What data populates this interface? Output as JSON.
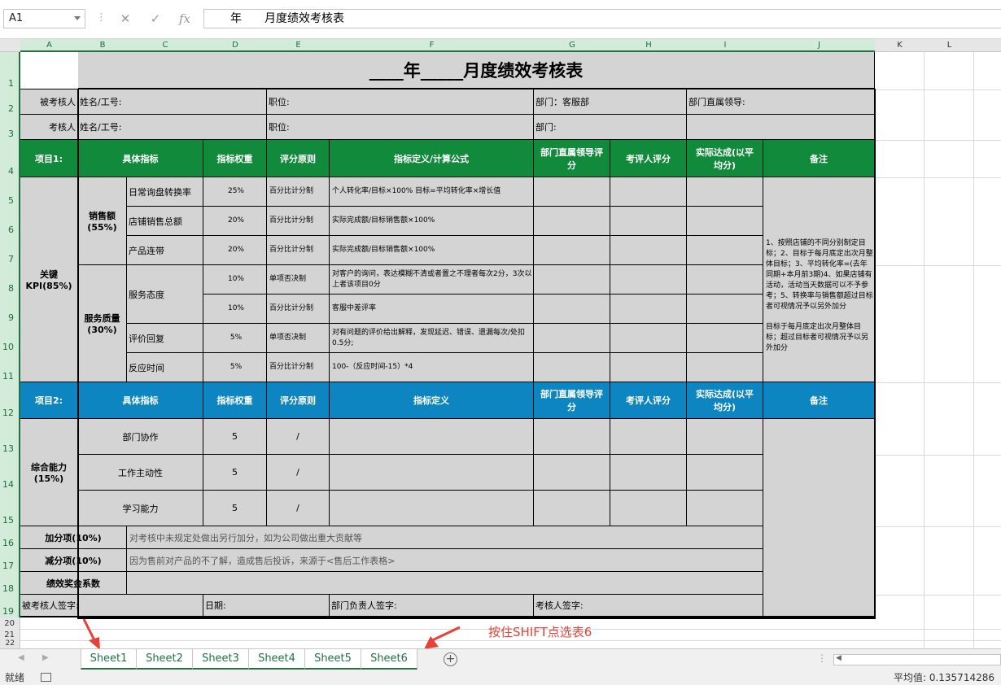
{
  "formula_bar": {
    "name_box": "A1",
    "cancel": "✕",
    "enter": "✓",
    "fx": "fx",
    "content": "年　　月度绩效考核表"
  },
  "columns": [
    "A",
    "B",
    "C",
    "D",
    "E",
    "F",
    "G",
    "H",
    "I",
    "J",
    "K",
    "L"
  ],
  "rows": [
    "1",
    "2",
    "3",
    "4",
    "5",
    "6",
    "7",
    "8",
    "9",
    "10",
    "11",
    "12",
    "13",
    "14",
    "15",
    "16",
    "17",
    "18",
    "19",
    "20",
    "21",
    "22"
  ],
  "title": "____年_____月度绩效考核表",
  "header": {
    "appraisee": "被考核人",
    "appraiser": "考核人",
    "name_id": "姓名/工号:",
    "position": "职位:",
    "dept_value": "部门：客服部",
    "dept": "部门:",
    "leader": "部门直属领导:"
  },
  "sec1": {
    "project": "项目1:",
    "indicator": "具体指标",
    "weight": "指标权重",
    "principle": "评分原则",
    "definition": "指标定义/计算公式",
    "leader_score": "部门直属领导评分",
    "reviewer_score": "考评人评分",
    "actual": "实际达成(以平均分)",
    "remarks": "备注"
  },
  "kpi": {
    "label": "关键KPI(85%)",
    "sales": "销售额(55%)",
    "service": "服务质量(30%)",
    "items": [
      {
        "name": "日常询盘转换率",
        "weight": "25%",
        "principle": "百分比计分制",
        "def": "个人转化率/目标×100% 目标=平均转化率×增长值"
      },
      {
        "name": "店铺销售总额",
        "weight": "20%",
        "principle": "百分比计分制",
        "def": "实际完成额/目标销售额×100%"
      },
      {
        "name": "产品连带",
        "weight": "20%",
        "principle": "百分比计分制",
        "def": "实际完成额/目标销售额×100%"
      },
      {
        "name": "服务态度",
        "weight": "10%",
        "principle": "单项否决制",
        "def": "对客户的询问，表达模糊不清或者置之不理者每次2分，3次以上者该项目0分"
      },
      {
        "name": "",
        "weight": "10%",
        "principle": "百分比计分制",
        "def": "客服中差评率"
      },
      {
        "name": "评价回复",
        "weight": "5%",
        "principle": "单项否决制",
        "def": "对有问题的评价给出解释，发现延迟、错误、遗漏每次/处扣0.5分;"
      },
      {
        "name": "反应时间",
        "weight": "5%",
        "principle": "百分比计分制",
        "def": "100-（反应时间-15）*4"
      }
    ],
    "remark_top": "1、按照店铺的不同分别制定目标；2、目标于每月底定出次月整体目标；3、平均转化率=(去年同期+本月前3期)4、如果店铺有活动，活动当天数据可以不予参考；5、转换率与销售额超过目标者可视情况予以另外加分",
    "remark_bottom": "目标于每月底定出次月整体目标；超过目标者可视情况予以另外加分"
  },
  "sec2": {
    "project": "项目2:",
    "indicator": "具体指标",
    "weight": "指标权重",
    "principle": "评分原则",
    "definition": "指标定义",
    "leader_score": "部门直属领导评分",
    "reviewer_score": "考评人评分",
    "actual": "实际达成(以平均分)",
    "remarks": "备注"
  },
  "ability": {
    "label": "综合能力(15%)",
    "items": [
      {
        "name": "部门协作",
        "weight": "5",
        "principle": "/"
      },
      {
        "name": "工作主动性",
        "weight": "5",
        "principle": "/"
      },
      {
        "name": "学习能力",
        "weight": "5",
        "principle": "/"
      }
    ]
  },
  "bonus": {
    "label": "加分项(10%)",
    "text": "对考核中未规定处做出另行加分，如为公司做出重大贡献等"
  },
  "deduct": {
    "label": "减分项(10%)",
    "text": "因为售前对产品的不了解，造成售后投诉，来源于<售后工作表格>"
  },
  "coefficient": {
    "label": "绩效奖金系数"
  },
  "signature": {
    "appraisee": "被考核人签字:",
    "date": "日期:",
    "dept_head": "部门负责人签字:",
    "appraiser": "考核人签字:"
  },
  "tabs": [
    "Sheet1",
    "Sheet2",
    "Sheet3",
    "Sheet4",
    "Sheet5",
    "Sheet6"
  ],
  "hint": "按住SHIFT点选表6",
  "status": {
    "ready": "就绪",
    "average": "平均值: 0.135714286"
  }
}
